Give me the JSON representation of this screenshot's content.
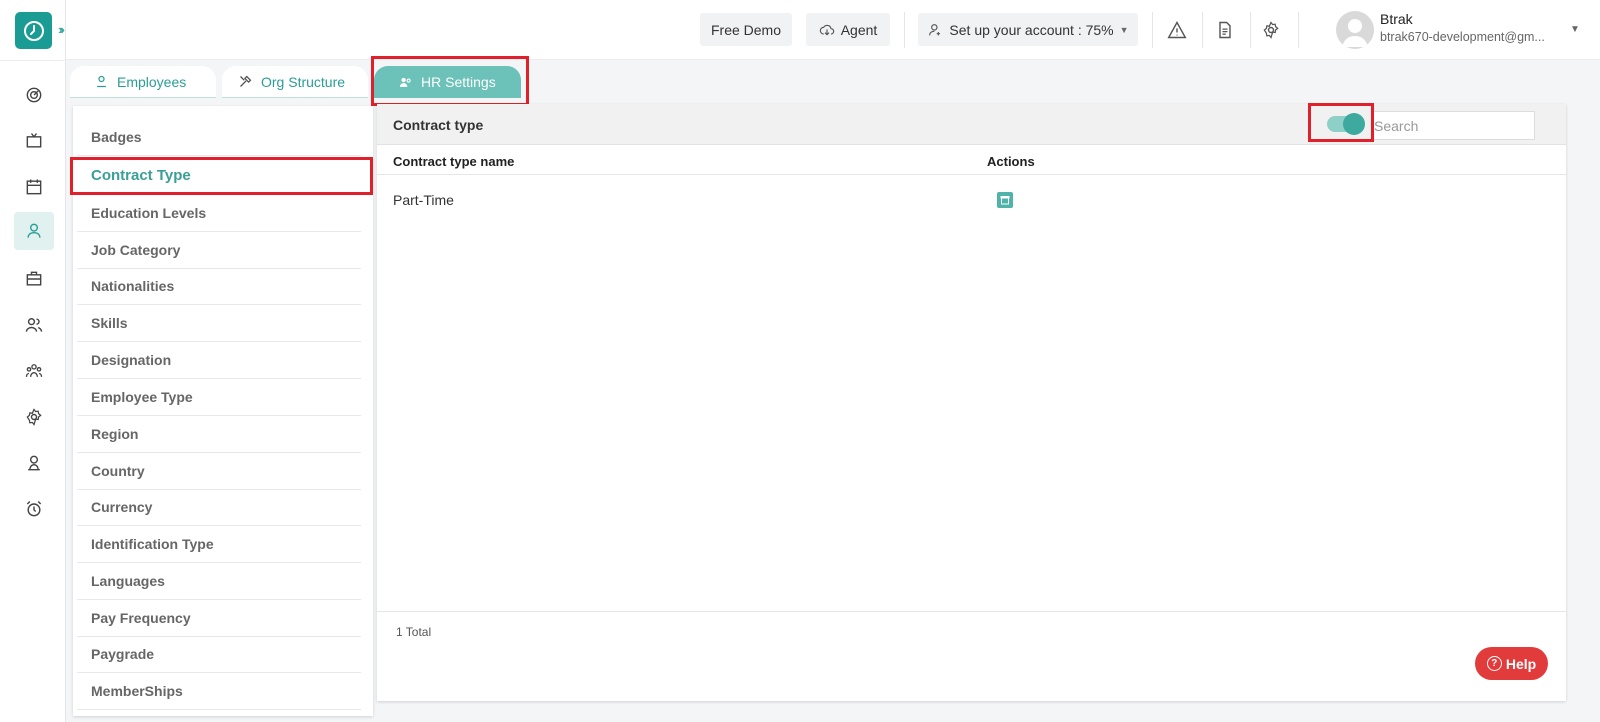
{
  "topbar": {
    "free_demo": "Free Demo",
    "agent": "Agent",
    "setup": "Set up your account : 75%",
    "user_name": "Btrak",
    "user_email": "btrak670-development@gm..."
  },
  "tabs": [
    {
      "label": "Employees",
      "icon": "person-icon"
    },
    {
      "label": "Org Structure",
      "icon": "tools-icon"
    },
    {
      "label": "HR Settings",
      "icon": "users-gear-icon"
    }
  ],
  "settings": {
    "items": [
      "Badges",
      "Contract Type",
      "Education Levels",
      "Job Category",
      "Nationalities",
      "Skills",
      "Designation",
      "Employee Type",
      "Region",
      "Country",
      "Currency",
      "Identification Type",
      "Languages",
      "Pay Frequency",
      "Paygrade",
      "MemberShips"
    ],
    "active": "Contract Type"
  },
  "panel": {
    "title": "Contract type",
    "search_placeholder": "Search",
    "columns": [
      "Contract type name",
      "Actions"
    ],
    "rows": [
      {
        "name": "Part-Time"
      }
    ],
    "total": "1 Total"
  },
  "help": "Help",
  "colors": {
    "accent": "#1a9c94",
    "highlight": "#e0202a",
    "help": "#e23b3b"
  }
}
